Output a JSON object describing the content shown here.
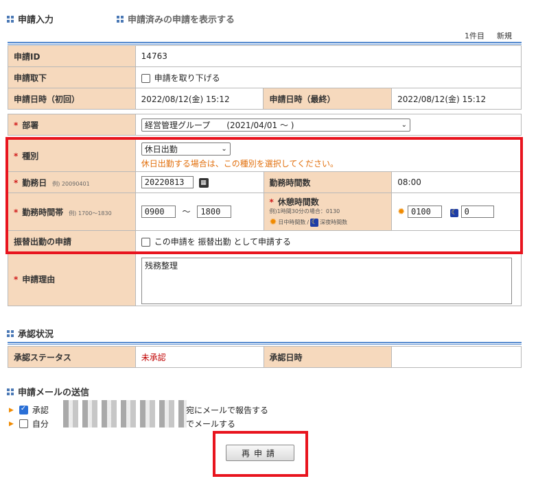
{
  "tabs": {
    "entry": "申請入力",
    "history": "申請済みの申請を表示する"
  },
  "count": {
    "label": "1件目",
    "new": "新規"
  },
  "form": {
    "id_label": "申請ID",
    "id_value": "14763",
    "withdraw_label": "申請取下",
    "withdraw_check": "申請を取り下げる",
    "date_first_label": "申請日時（初回）",
    "date_first": "2022/08/12(金) 15:12",
    "date_last_label": "申請日時（最終）",
    "date_last": "2022/08/12(金) 15:12",
    "dept_label": "部署",
    "dept_value": "経営管理グループ　　(2021/04/01 ～ )",
    "type_label": "種別",
    "type_value": "休日出勤",
    "type_note": "休日出勤する場合は、この種別を選択してください。",
    "workday_label": "勤務日",
    "workday_hint": "例) 20090401",
    "workday_value": "20220813",
    "hours_label": "勤務時間数",
    "hours_value": "08:00",
    "band_label": "勤務時間帯",
    "band_hint": "例) 1700～1830",
    "band_from": "0900",
    "band_sep": "～",
    "band_to": "1800",
    "break_label": "休憩時間数",
    "break_hint": "例)1時間30分の場合：0130",
    "break_day_legend": "日中時間数",
    "break_slash": "/",
    "break_night_legend": "深夜時間数",
    "break_day": "0100",
    "break_night": "0",
    "substitute_label": "振替出勤の申請",
    "substitute_check": "この申請を 振替出勤 として申請する",
    "reason_label": "申請理由",
    "reason_value": "残務整理"
  },
  "approval": {
    "title": "承認状況",
    "status_label": "承認ステータス",
    "status_value": "未承認",
    "date_label": "承認日時",
    "date_value": ""
  },
  "mail": {
    "title": "申請メールの送信",
    "row1_start": "承認",
    "row1_end": "宛にメールで報告する",
    "row2_start": "自分",
    "row2_end": "でメールする"
  },
  "submit_label": "再申請",
  "colors": {
    "label_bg": "#f6d9bd",
    "highlight": "#e8141e",
    "rule": "#5b8ed0",
    "warn": "#e2700e",
    "status": "#c00000"
  }
}
